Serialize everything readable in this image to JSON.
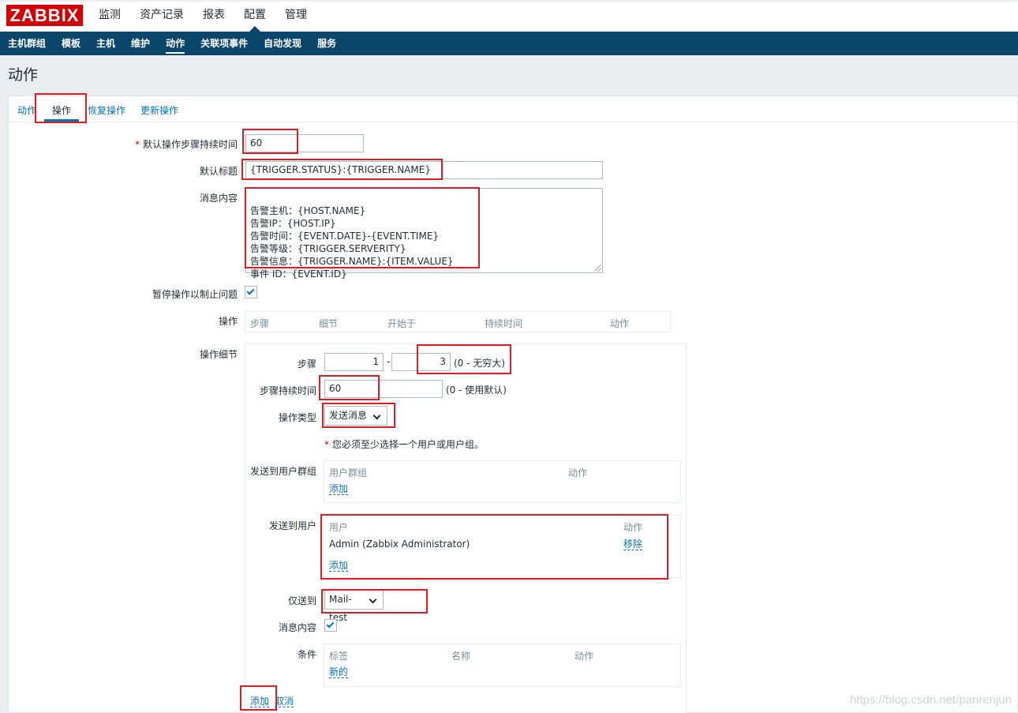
{
  "logo": "ZABBIX",
  "top_nav": [
    "监测",
    "资产记录",
    "报表",
    "配置",
    "管理"
  ],
  "top_nav_active": "配置",
  "sub_nav": [
    "主机群组",
    "模板",
    "主机",
    "维护",
    "动作",
    "关联项事件",
    "自动发现",
    "服务"
  ],
  "sub_nav_active": "动作",
  "page_title": "动作",
  "tabs": [
    "动作",
    "操作",
    "恢复操作",
    "更新操作"
  ],
  "tab_active": "操作",
  "form": {
    "default_step_duration_label": "默认操作步骤持续时间",
    "default_step_duration_value": "60",
    "default_subject_label": "默认标题",
    "default_subject_value": "{TRIGGER.STATUS}:{TRIGGER.NAME}",
    "message_label": "消息内容",
    "message_value": "告警主机：{HOST.NAME}\n告警IP：{HOST.IP}\n告警时间：{EVENT.DATE}-{EVENT.TIME}\n告警等级：{TRIGGER.SERVERITY}\n告警信息：{TRIGGER.NAME}:{ITEM.VALUE}\n事件 ID：{EVENT.ID}",
    "pause_label": "暂停操作以制止问题",
    "pause_checked": true,
    "operations_label": "操作",
    "operations_headers": [
      "步骤",
      "细节",
      "开始于",
      "持续时间",
      "动作"
    ],
    "op_details_label": "操作细节"
  },
  "details": {
    "steps_label": "步骤",
    "step_from": "1",
    "step_sep": "-",
    "step_to": "3",
    "step_hint": "(0 - 无穷大)",
    "step_duration_label": "步骤持续时间",
    "step_duration_value": "60",
    "step_duration_hint": "(0 - 使用默认)",
    "op_type_label": "操作类型",
    "op_type_value": "发送消息",
    "required_note": "您必须至少选择一个用户或用户组。",
    "send_to_groups_label": "发送到用户群组",
    "groups_headers": [
      "用户群组",
      "动作"
    ],
    "groups_add": "添加",
    "send_to_users_label": "发送到用户",
    "users_headers": [
      "用户",
      "动作"
    ],
    "users_rows": [
      {
        "name": "Admin (Zabbix Administrator)",
        "action": "移除"
      }
    ],
    "users_add": "添加",
    "send_only_label": "仅送到",
    "send_only_value": "Mail-test",
    "default_message_label": "消息内容",
    "default_message_checked": true,
    "conditions_label": "条件",
    "conditions_headers": [
      "标签",
      "名称",
      "动作"
    ],
    "conditions_new": "新的",
    "add_link": "添加",
    "cancel_link": "取消"
  },
  "watermark": "https://blog.csdn.net/panrenjun",
  "highlight_color": "#e01b24"
}
